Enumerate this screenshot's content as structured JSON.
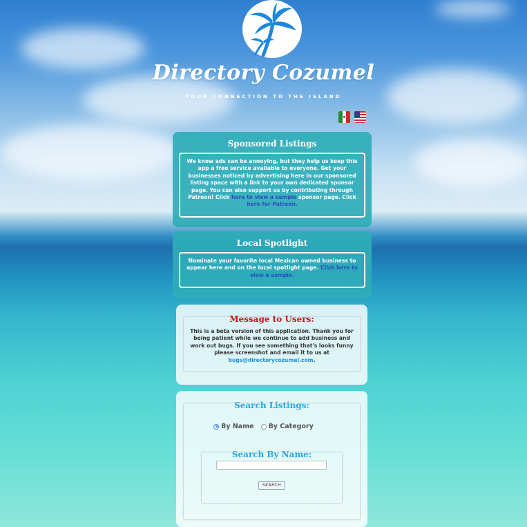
{
  "brand": {
    "name": "Directory Cozumel",
    "tagline": "YOUR CONNECTION TO THE ISLAND"
  },
  "languages": [
    {
      "code": "es",
      "icon": "mexico-flag-icon"
    },
    {
      "code": "en",
      "icon": "usa-flag-icon"
    }
  ],
  "sponsored": {
    "title": "Sponsored Listings",
    "text_before": "We know ads can be annoying, but they help us keep this app a free service available to everyone. Get your businesses noticed by advertising here in our sponsored listing space with a link to your own dedicated sponsor page. You can also support us by contributing through Patreon! Click ",
    "link_sample": "here to view a sample",
    "text_middle": " sponsor page. Click ",
    "link_patreon": "here for Patreon."
  },
  "spotlight": {
    "title": "Local Spotlight",
    "text_before": "Nominate your favorite local Mexican owned business to appear here and on the local spotlight page. ",
    "link_sample": "Click here to view a sample."
  },
  "message": {
    "title": "Message to Users:",
    "text_before": "This is a beta version of this application. Thank you for being patient while we continue to add business and work out bugs. If you see something that's looks funny please screenshot and email it to us at ",
    "email": "bugs@directorycozumel.com",
    "text_after": "."
  },
  "search": {
    "title": "Search Listings:",
    "option_name": "By Name",
    "option_category": "By Category",
    "selected": "By Name",
    "by_name_title": "Search By Name:",
    "input_value": "",
    "button_label": "SEARCH"
  },
  "colors": {
    "teal_panel": "#2facb9",
    "message_title": "#c0161c",
    "search_title": "#27a6e0",
    "link_blue": "#2a4fbf"
  }
}
